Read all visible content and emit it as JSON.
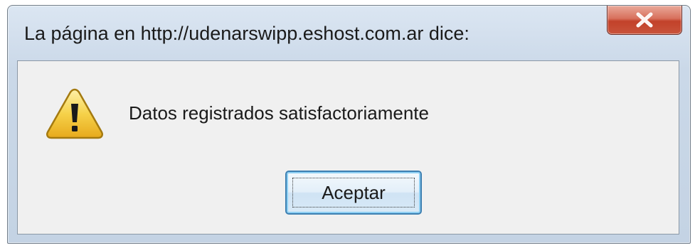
{
  "dialog": {
    "title": "La página en http://udenarswipp.eshost.com.ar dice:",
    "message": "Datos registrados satisfactoriamente",
    "ok_label": "Aceptar",
    "icon": "warning-icon",
    "close_icon": "close-icon"
  },
  "colors": {
    "close_button": "#c7442c",
    "content_background": "#f0f0f0",
    "warning_yellow": "#f3c93a",
    "button_border": "#3c7fb1"
  }
}
